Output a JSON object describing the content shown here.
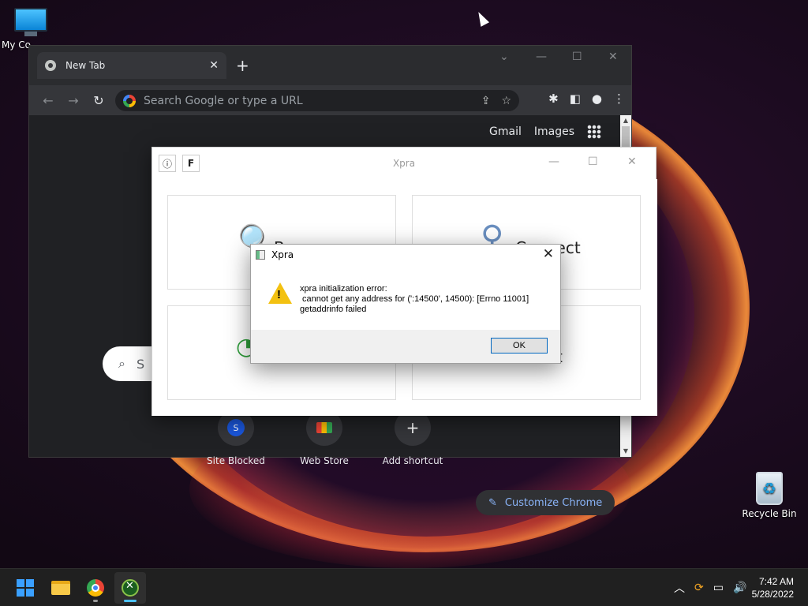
{
  "desktop": {
    "icons": [
      {
        "label": "My Co"
      },
      {
        "label": "Recycle Bin"
      }
    ]
  },
  "chrome": {
    "tab_title": "New Tab",
    "tab_close": "✕",
    "new_tab": "+",
    "omnibox_placeholder": "Search Google or type a URL",
    "links": {
      "gmail": "Gmail",
      "images": "Images"
    },
    "search_placeholder": "S",
    "shortcuts": [
      {
        "label": "Site Blocked",
        "badge": "S"
      },
      {
        "label": "Web Store"
      },
      {
        "label": "Add shortcut",
        "glyph": "+"
      }
    ],
    "customize_label": "Customize Chrome"
  },
  "xpra_window": {
    "title": "Xpra",
    "cards": [
      {
        "text": "B",
        "icon": "magnifier-icon"
      },
      {
        "text": "Connect",
        "icon": "connect-icon"
      },
      {
        "text": "",
        "icon": "wifi-icon"
      },
      {
        "text": "t",
        "icon": "monitor-icon"
      }
    ]
  },
  "dialog": {
    "title": "Xpra",
    "message_line1": "xpra initialization error:",
    "message_line2": " cannot get any address for (':14500', 14500): [Errno 11001]",
    "message_line3": "getaddrinfo failed",
    "ok_label": "OK",
    "close_glyph": "✕"
  },
  "taskbar": {
    "time": "7:42 AM",
    "date": "5/28/2022"
  },
  "colors": {
    "accent": "#4cc2ff",
    "chrome_dark": "#202124",
    "warning": "#f3c111",
    "link_blue": "#8ab4f8"
  }
}
